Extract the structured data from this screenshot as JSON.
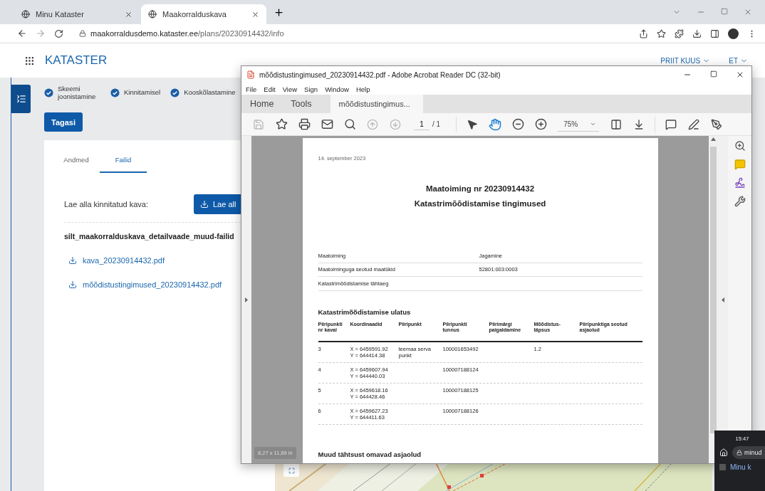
{
  "browser": {
    "tabs": [
      {
        "title": "Minu Kataster",
        "selected": false
      },
      {
        "title": "Maakorralduskava",
        "selected": true
      }
    ],
    "address": {
      "host": "maakorraldusdemo.kataster.ee",
      "path": "/plans/20230914432/info"
    }
  },
  "header": {
    "brand": "KATASTER",
    "user": "PRIIT KUUS",
    "language": "ET"
  },
  "steps": [
    {
      "label": "Skeemi joonistamine",
      "done": true
    },
    {
      "label": "Kinnitamisel",
      "done": true
    },
    {
      "label": "Kooskõlastamine",
      "done": true
    }
  ],
  "back_button": "Tagasi",
  "tabs": [
    {
      "label": "Andmed",
      "selected": false
    },
    {
      "label": "Failid",
      "selected": true
    }
  ],
  "download": {
    "label": "Lae alla kinnitatud kava:",
    "button": "Lae all"
  },
  "files_heading": "silt_maakorralduskava_detailvaade_muud-failid",
  "files": [
    "kava_20230914432.pdf",
    "mõõdistustingimused_20230914432.pdf"
  ],
  "map": {
    "kind": "picture"
  },
  "acrobat": {
    "title": "mõõdistustingimused_20230914432.pdf - Adobe Acrobat Reader DC (32-bit)",
    "menu": [
      "File",
      "Edit",
      "View",
      "Sign",
      "Window",
      "Help"
    ],
    "tabs": [
      {
        "label": "Home",
        "selected": false
      },
      {
        "label": "Tools",
        "selected": false
      },
      {
        "label": "mõõdistustingimus...",
        "selected": true
      }
    ],
    "page_number": "1",
    "page_total": "/ 1",
    "zoom": "75%",
    "page_size": "8,27 x 11,69 in",
    "document": {
      "date": "14. september 2023",
      "title": "Maatoiming nr 20230914432",
      "subtitle": "Katastrimõõdistamise tingimused",
      "info": [
        {
          "label": "Maatoiming",
          "value": "Jagamine"
        },
        {
          "label": "Maatoiminguga seotud maatükid",
          "value": "52801:003:0003"
        },
        {
          "label": "Katastrimõõdistamise tähtaeg"
        }
      ],
      "section": "Katastrimõõdistamise ulatus",
      "columns": [
        "Piiripunkti nr kaval",
        "Koordinaadid",
        "Piiripunkt",
        "Piiripunkti tunnus",
        "Piirimärgi paigaldamine",
        "Mõõdistus-täpsus",
        "Piiripunktiga seotud asjaolud"
      ],
      "rows": [
        {
          "nr": "3",
          "x": "X = 6459591.92",
          "y": "Y = 644414.38",
          "point": "teemaa serva punkt",
          "id": "100001653492",
          "accuracy": "1.2"
        },
        {
          "nr": "4",
          "x": "X = 6459607.94",
          "y": "Y = 644440.03",
          "id": "100007188124"
        },
        {
          "nr": "5",
          "x": "X = 6459618.16",
          "y": "Y = 644428.46",
          "id": "100007188125"
        },
        {
          "nr": "6",
          "x": "X = 6459627.23",
          "y": "Y = 644411.63",
          "id": "100007188126"
        }
      ],
      "section_2": "Muud tähtsust omavad asjaolud"
    }
  },
  "phone": {
    "time": "15:47",
    "url": "minud",
    "item": "Minu k"
  }
}
